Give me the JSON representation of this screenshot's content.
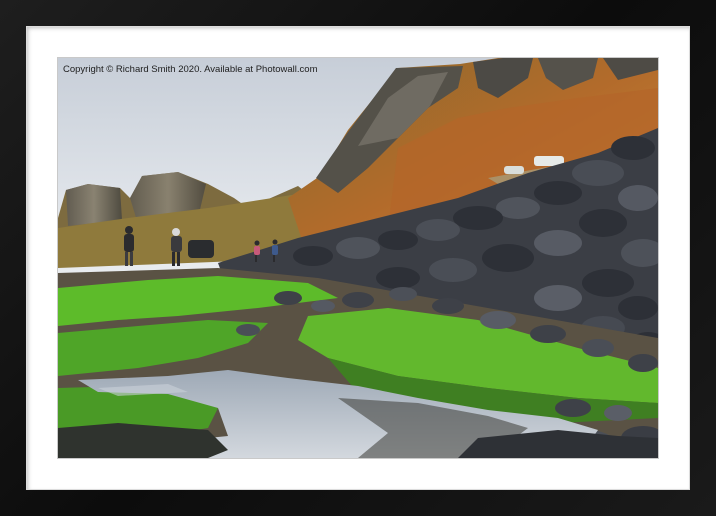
{
  "product": {
    "type": "framed-mounted-print",
    "frame_color": "#141414",
    "mount_color": "#ffffff"
  },
  "photo": {
    "watermark": "Copyright © Richard Smith 2020. Available at Photowall.com"
  },
  "colors": {
    "sky": "#d9dee5",
    "moss": "#5dbb2a",
    "hillside": "#b06a2a",
    "rock": "#3a3d44",
    "water": "#aeb8c4"
  }
}
